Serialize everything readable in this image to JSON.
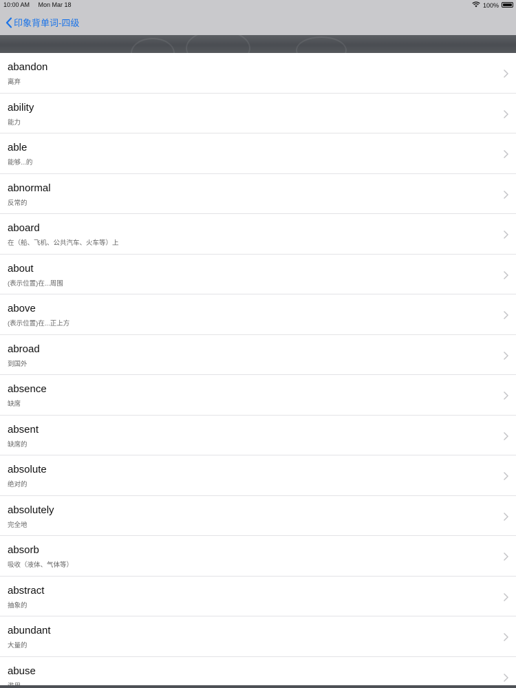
{
  "status_bar": {
    "time": "10:00 AM",
    "date": "Mon Mar 18",
    "battery_text": "100%",
    "battery_level": 1.0,
    "wifi_icon": "wifi-icon",
    "battery_icon": "battery-icon"
  },
  "nav": {
    "back_label": "印象背单词-四级",
    "back_icon": "chevron-left-icon",
    "accent_color": "#1a73e8"
  },
  "words": [
    {
      "word": "abandon",
      "meaning": "离弃"
    },
    {
      "word": "ability",
      "meaning": "能力"
    },
    {
      "word": "able",
      "meaning": "能够...的"
    },
    {
      "word": "abnormal",
      "meaning": "反常的"
    },
    {
      "word": "aboard",
      "meaning": "在（船、飞机、公共汽车、火车等）上"
    },
    {
      "word": "about",
      "meaning": "(表示位置)在...周围"
    },
    {
      "word": "above",
      "meaning": "(表示位置)在...正上方"
    },
    {
      "word": "abroad",
      "meaning": "到国外"
    },
    {
      "word": "absence",
      "meaning": "缺席"
    },
    {
      "word": "absent",
      "meaning": "缺席的"
    },
    {
      "word": "absolute",
      "meaning": "绝对的"
    },
    {
      "word": "absolutely",
      "meaning": "完全地"
    },
    {
      "word": "absorb",
      "meaning": "吸收（液体、气体等）"
    },
    {
      "word": "abstract",
      "meaning": "抽象的"
    },
    {
      "word": "abundant",
      "meaning": "大量的"
    },
    {
      "word": "abuse",
      "meaning": "滥用"
    }
  ]
}
